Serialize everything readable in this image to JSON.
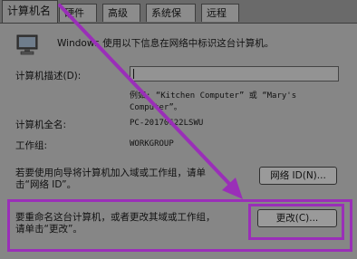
{
  "tabs": [
    "计算机名",
    "硬件",
    "高级",
    "系统保护",
    "远程"
  ],
  "intro_text": "Windows 使用以下信息在网络中标识这台计算机。",
  "description": {
    "label": "计算机描述(D):",
    "value": "",
    "example_line1": "例如: “Kitchen Computer” 或 “Mary's",
    "example_line2": "Computer”。"
  },
  "full_name": {
    "label": "计算机全名:",
    "value": "PC-20170622LSWU"
  },
  "workgroup": {
    "label": "工作组:",
    "value": "WORKGROUP"
  },
  "network_id": {
    "text_line1": "若要使用向导将计算机加入域或工作组，请单",
    "text_line2": "击“网络 ID”。",
    "button_label": "网络 ID(N)..."
  },
  "rename": {
    "text_line1": "要重命名这台计算机，或者更改其域或工作组，",
    "text_line2": "请单击“更改”。",
    "button_label": "更改(C)..."
  },
  "colors": {
    "annotation": "#9a2fb8",
    "panel": "#868686",
    "window_background": "#5d5d5d"
  },
  "icons": [
    "computer-monitor-icon"
  ]
}
